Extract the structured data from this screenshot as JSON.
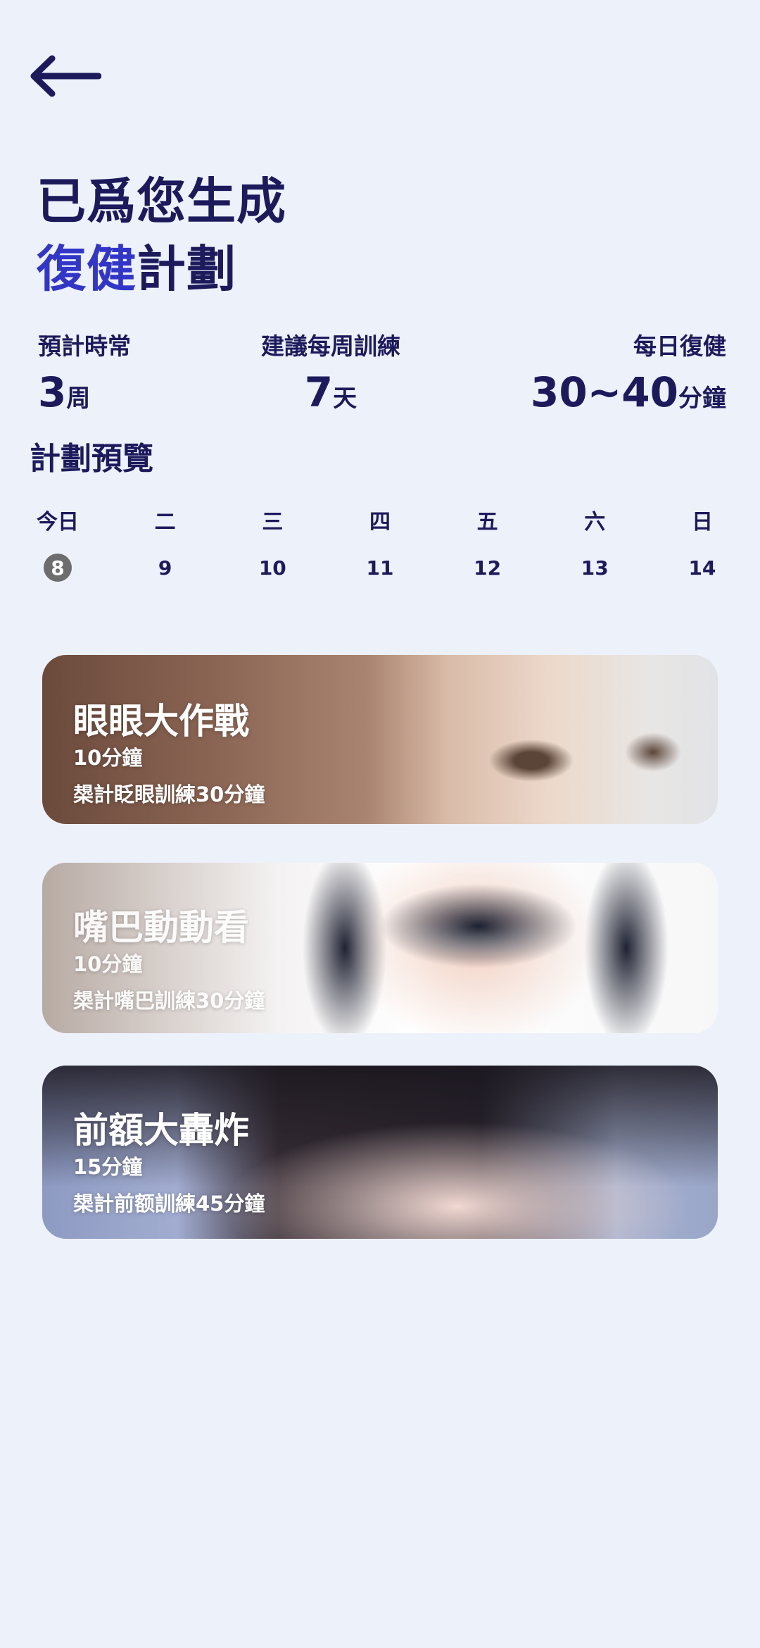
{
  "header": {
    "back_icon": "arrow-left-icon",
    "title_line1": "已爲您生成",
    "title_accent": "復健",
    "title_rest": "計劃",
    "colors": {
      "text": "#1d1a5c",
      "accent": "#3236c8",
      "background": "#edf1fa"
    }
  },
  "stats": [
    {
      "label": "預計時常",
      "value": "3",
      "unit": "周"
    },
    {
      "label": "建議每周訓練",
      "value": "7",
      "unit": "天"
    },
    {
      "label": "每日復健",
      "value": "30~40",
      "unit": "分鐘"
    }
  ],
  "preview": {
    "title": "計劃預覽",
    "days": [
      {
        "name": "今日",
        "date": "8",
        "today": true
      },
      {
        "name": "二",
        "date": "9"
      },
      {
        "name": "三",
        "date": "10"
      },
      {
        "name": "四",
        "date": "11"
      },
      {
        "name": "五",
        "date": "12"
      },
      {
        "name": "六",
        "date": "13"
      },
      {
        "name": "日",
        "date": "14"
      }
    ]
  },
  "cards": [
    {
      "title": "眼眼大作戰",
      "duration": "10分鐘",
      "total": "槼計眨眼訓練30分鐘"
    },
    {
      "title": "嘴巴動動看",
      "duration": "10分鐘",
      "total": "槼計嘴巴訓練30分鐘"
    },
    {
      "title": "前額大轟炸",
      "duration": "15分鐘",
      "total": "槼計前额訓練45分鐘"
    }
  ]
}
